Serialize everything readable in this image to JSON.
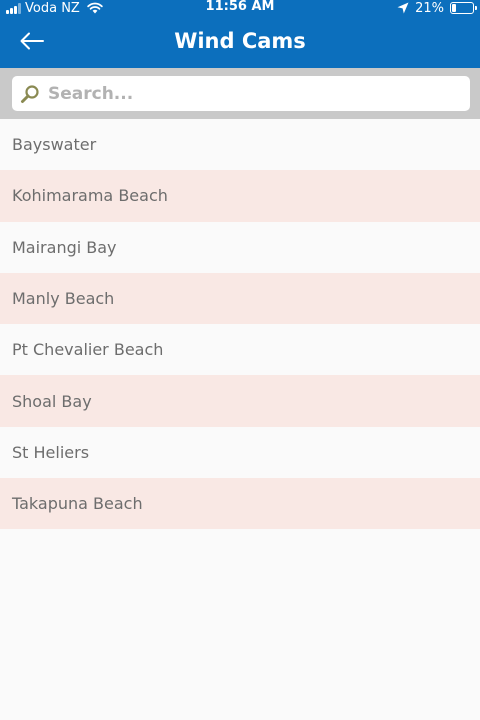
{
  "status_bar": {
    "carrier": "Voda NZ",
    "time": "11:56 AM",
    "battery": "21%",
    "battery_level": 0.21
  },
  "header": {
    "title": "Wind Cams",
    "back_icon": "arrow-left-icon",
    "color": "#0c6fbd"
  },
  "search": {
    "placeholder": "Search...",
    "value": "",
    "icon": "search-icon"
  },
  "locations": [
    {
      "label": "Bayswater"
    },
    {
      "label": "Kohimarama Beach"
    },
    {
      "label": "Mairangi Bay"
    },
    {
      "label": "Manly Beach"
    },
    {
      "label": "Pt Chevalier Beach"
    },
    {
      "label": "Shoal Bay"
    },
    {
      "label": "St Heliers"
    },
    {
      "label": "Takapuna Beach"
    }
  ],
  "colors": {
    "row_alt": "#f9e8e4",
    "row": "#fafafa",
    "search_band": "#c9c9c9"
  }
}
